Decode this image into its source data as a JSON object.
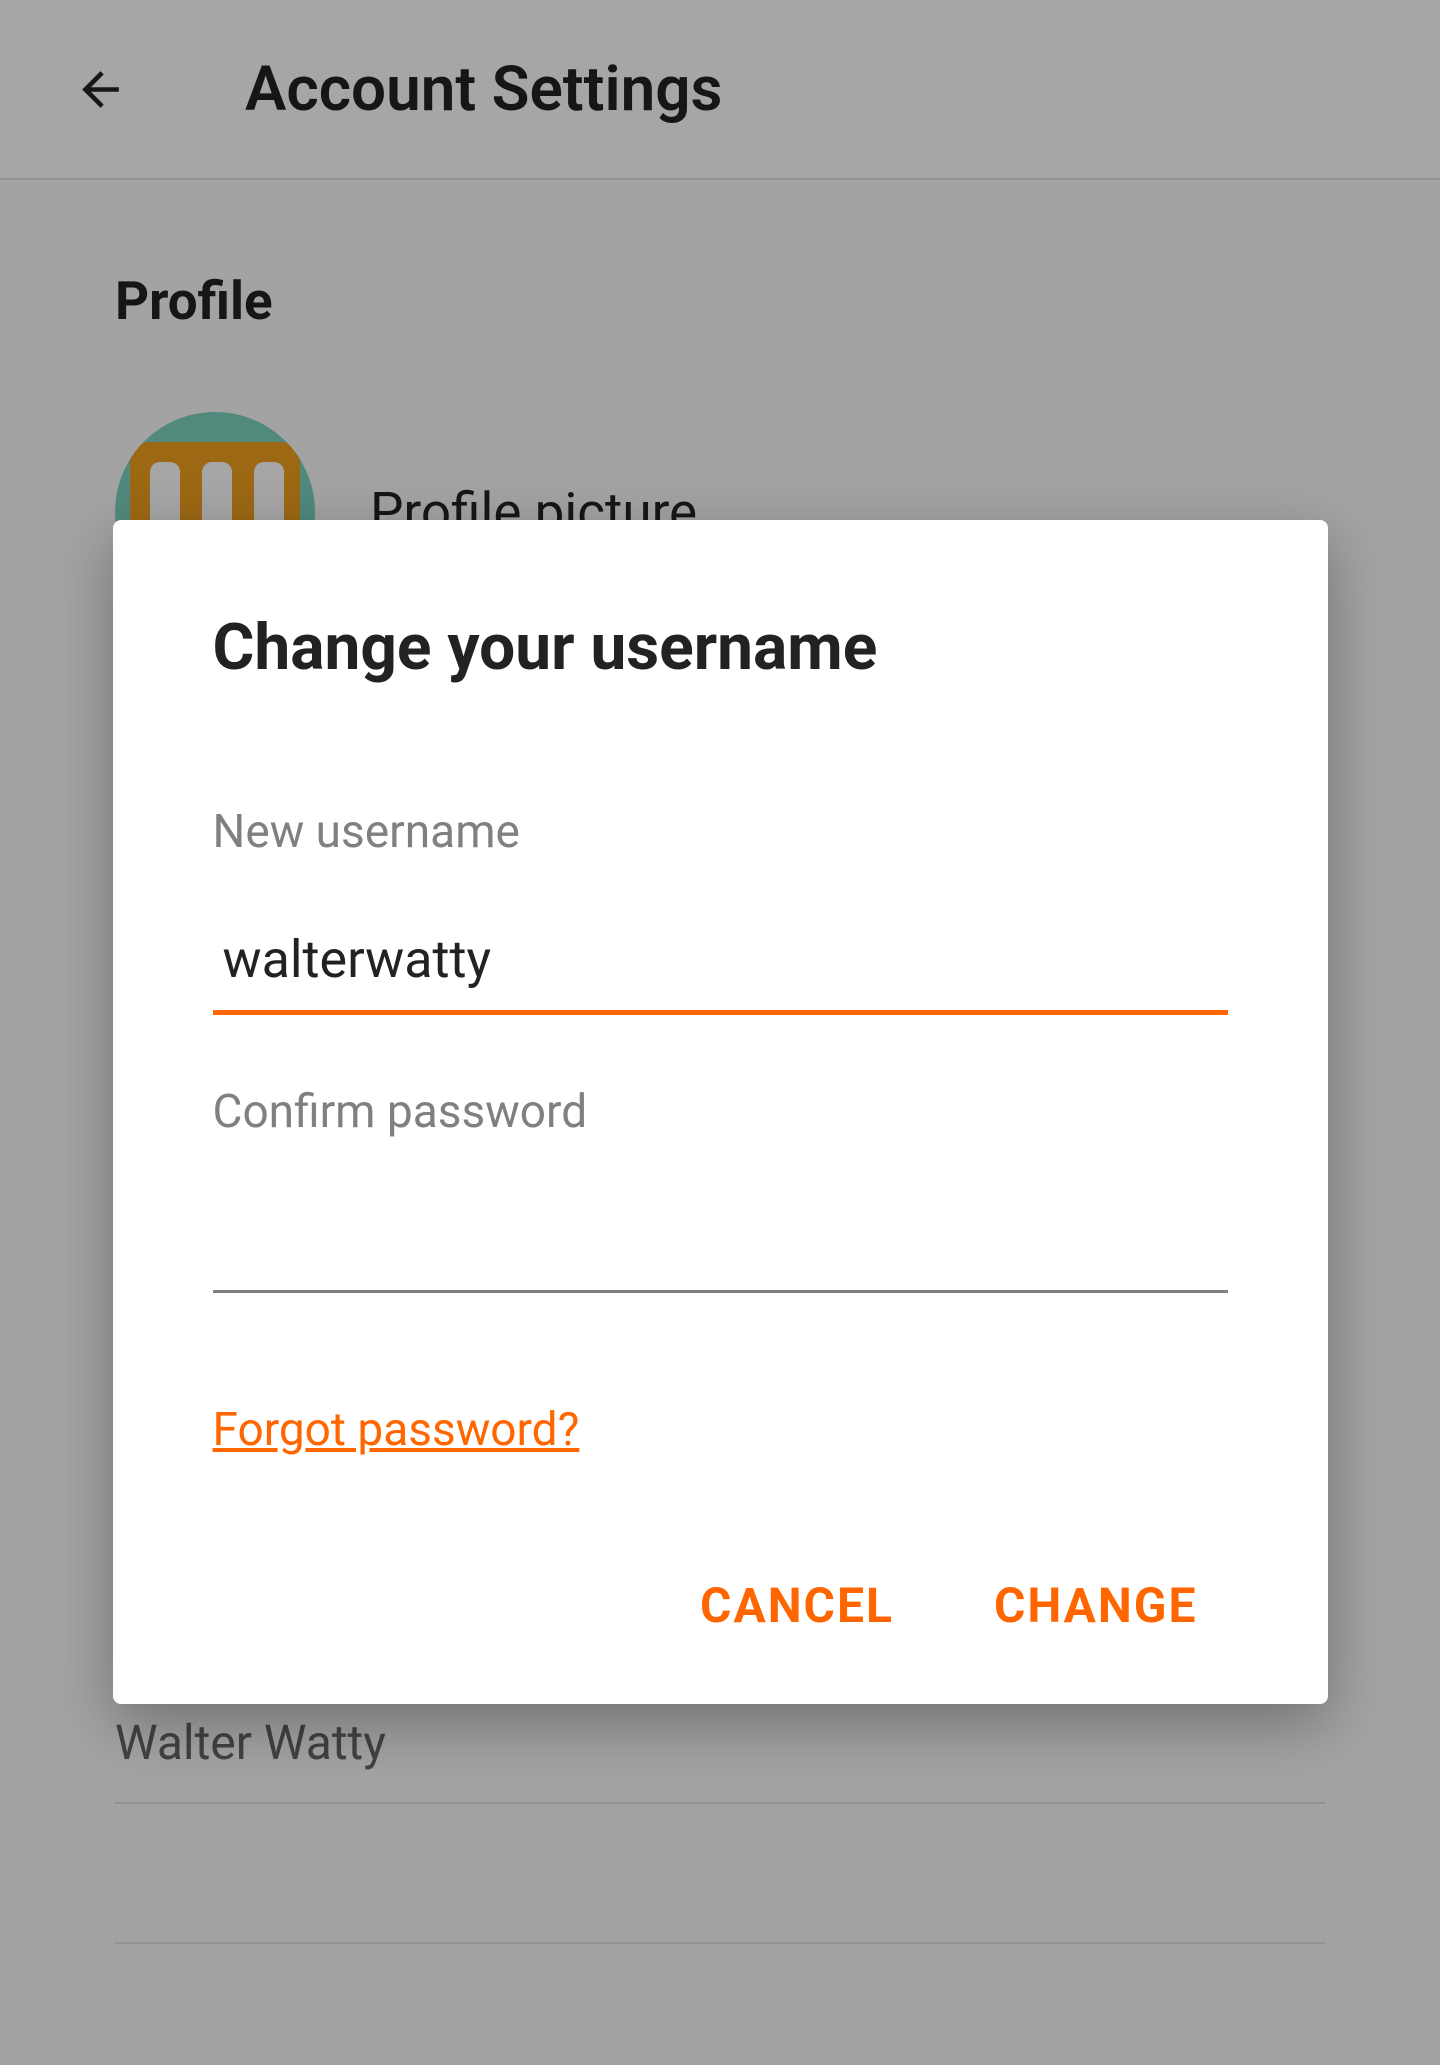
{
  "header": {
    "title": "Account Settings"
  },
  "profile": {
    "section_title": "Profile",
    "picture_label": "Profile picture",
    "display_name": "Walter Watty"
  },
  "dialog": {
    "title": "Change your username",
    "new_username_label": "New username",
    "new_username_value": "walterwatty",
    "confirm_password_label": "Confirm password",
    "confirm_password_value": "",
    "forgot_password_label": "Forgot password?",
    "cancel_label": "CANCEL",
    "change_label": "CHANGE"
  },
  "colors": {
    "accent": "#ff6600",
    "text_primary": "#222222",
    "text_secondary": "#808080"
  }
}
